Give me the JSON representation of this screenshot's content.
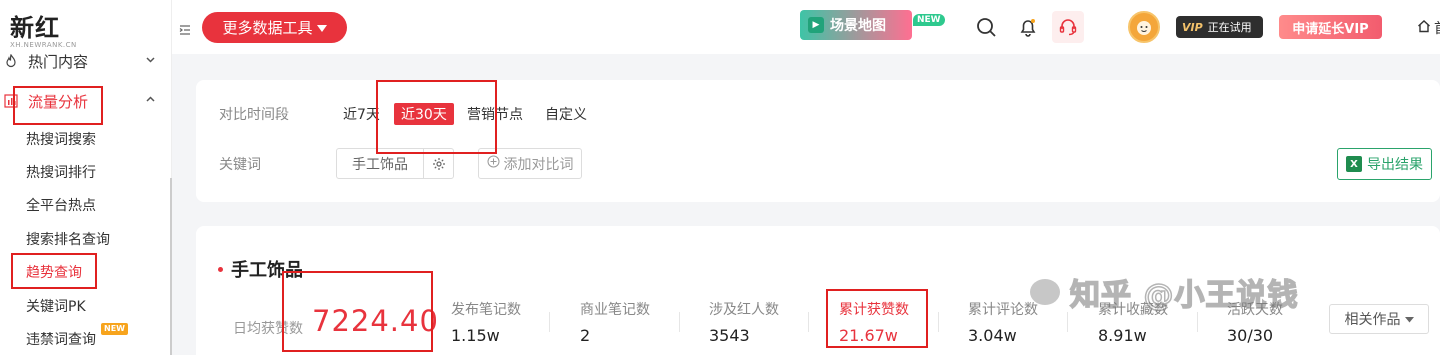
{
  "brand": {
    "name": "新红",
    "sub": "XH.NEWRANK.CN"
  },
  "sidebar": {
    "groups": [
      {
        "label": "热门内容",
        "icon": "fire-icon"
      },
      {
        "label": "流量分析",
        "icon": "bar-chart-icon"
      }
    ],
    "items": [
      {
        "label": "热搜词搜索"
      },
      {
        "label": "热搜词排行"
      },
      {
        "label": "全平台热点"
      },
      {
        "label": "搜索排名查询"
      },
      {
        "label": "趋势查询"
      },
      {
        "label": "关键词PK"
      },
      {
        "label": "违禁词查询"
      }
    ],
    "new_badge": "NEW"
  },
  "topbar": {
    "more_tools": "更多数据工具",
    "scene_map": "场景地图",
    "scene_new": "NEW",
    "vip_tag": "VIP",
    "vip_status": "正在试用",
    "extend_vip": "申请延长VIP",
    "home": "首"
  },
  "filter": {
    "period_label": "对比时间段",
    "periods": [
      "近7天",
      "近30天",
      "营销节点",
      "自定义"
    ],
    "active_period": "近30天",
    "keyword_label": "关键词",
    "keyword_value": "手工饰品",
    "add_compare": "添加对比词",
    "export": "导出结果"
  },
  "stats": {
    "title": "手工饰品",
    "primary_label": "日均获赞数",
    "primary_value": "7224.40",
    "items": [
      {
        "label": "发布笔记数",
        "value": "1.15w"
      },
      {
        "label": "商业笔记数",
        "value": "2"
      },
      {
        "label": "涉及红人数",
        "value": "3543"
      },
      {
        "label": "累计获赞数",
        "value": "21.67w"
      },
      {
        "label": "累计评论数",
        "value": "3.04w"
      },
      {
        "label": "累计收藏数",
        "value": "8.91w"
      },
      {
        "label": "活跃天数",
        "value": "30/30"
      }
    ],
    "related": "相关作品"
  },
  "watermark": "知乎 @小王说钱",
  "colors": {
    "accent": "#e8333d",
    "annotation": "#e02020",
    "export_green": "#2aa36b"
  }
}
